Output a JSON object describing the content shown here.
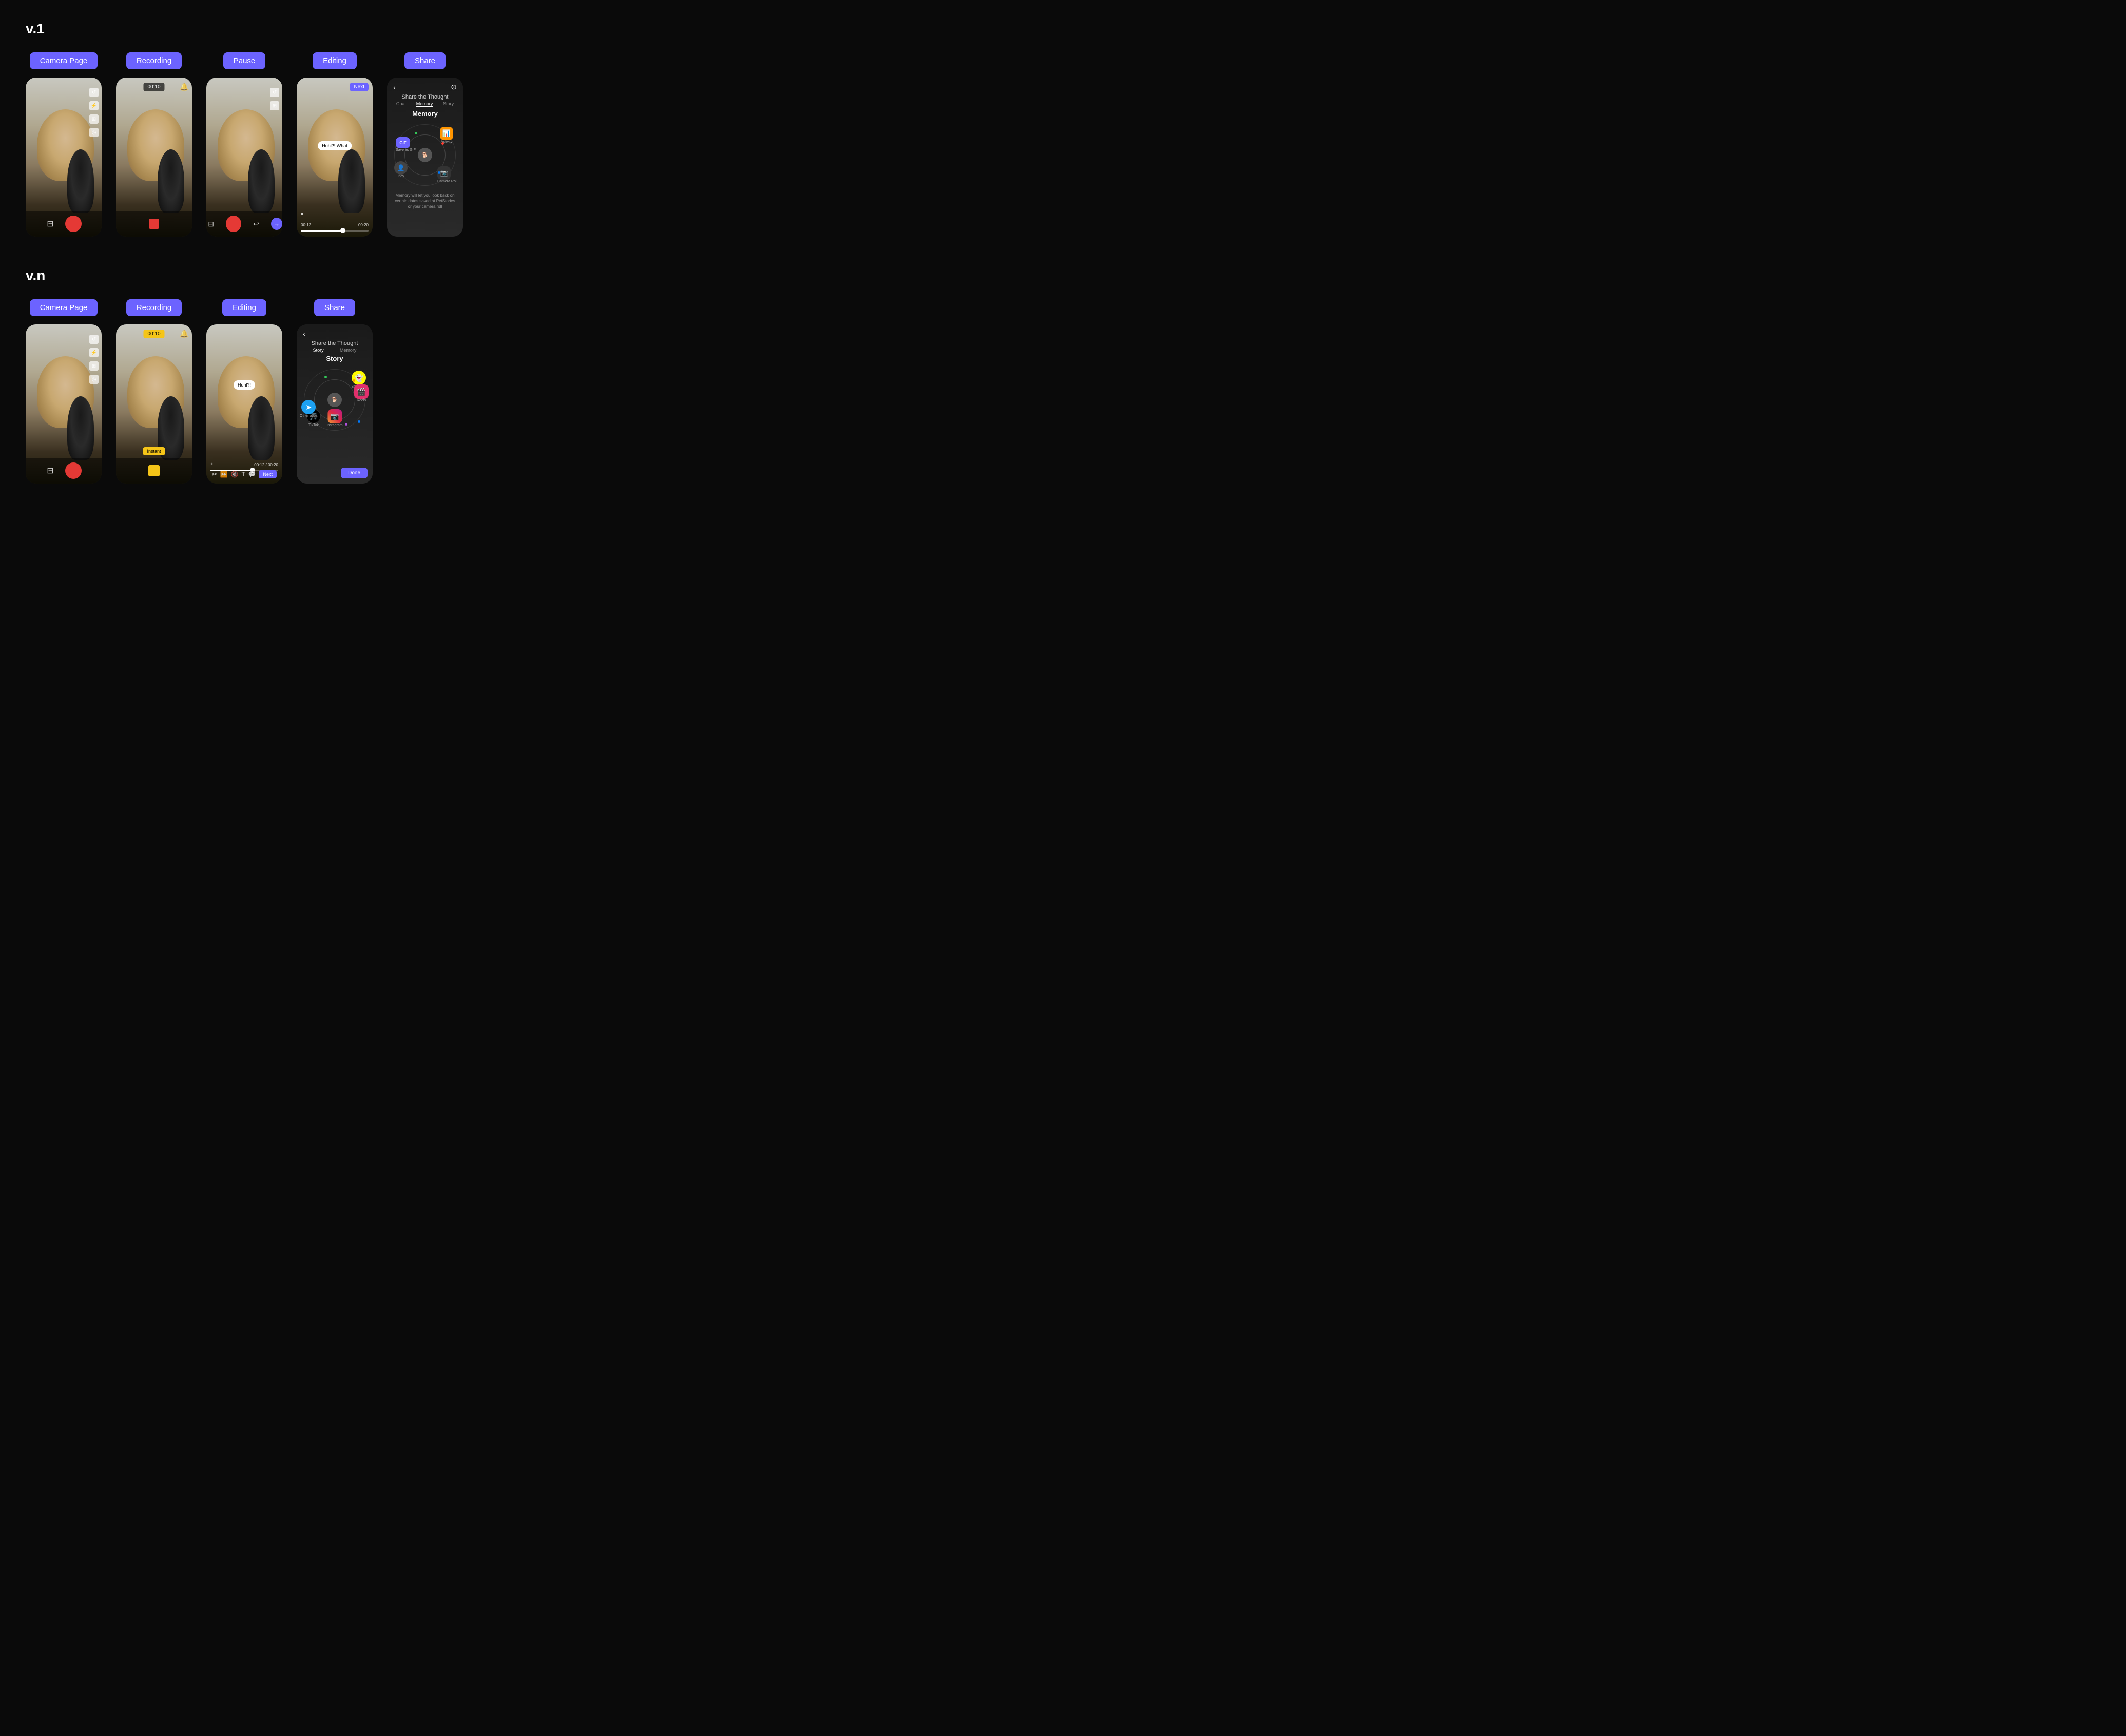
{
  "v1": {
    "label": "v.1",
    "screens": [
      {
        "id": "camera-page",
        "badge": "Camera Page",
        "type": "camera"
      },
      {
        "id": "recording",
        "badge": "Recording",
        "type": "recording",
        "timer": "00:10"
      },
      {
        "id": "pause",
        "badge": "Pause",
        "type": "pause"
      },
      {
        "id": "editing",
        "badge": "Editing",
        "type": "editing-v1",
        "next_label": "Next",
        "caption": "Huhl?! What",
        "time_current": "00:12",
        "time_total": "00:20"
      },
      {
        "id": "share",
        "badge": "Share",
        "type": "share-v1",
        "title": "Share the Thought",
        "subtitle": "Memory",
        "nav_items": [
          "Chat",
          "Memory",
          "Story"
        ],
        "items": [
          {
            "label": "GIF",
            "color": "#6c63ff"
          },
          {
            "label": "Activity",
            "color": "#ff9500"
          },
          {
            "label": "Save as GIF",
            "color": "#6c63ff"
          },
          {
            "label": "Indy",
            "color": "#666"
          },
          {
            "label": "Camera Roll",
            "color": "#555"
          }
        ],
        "footer": "Memory will let you look back on certain dates saved at PetStories or your camera roll"
      }
    ]
  },
  "v2": {
    "label": "v.n",
    "screens": [
      {
        "id": "camera-page-v2",
        "badge": "Camera Page",
        "type": "camera"
      },
      {
        "id": "recording-v2",
        "badge": "Recording",
        "type": "recording-v2",
        "timer": "00:10",
        "instant_label": "Instant"
      },
      {
        "id": "editing-v2",
        "badge": "Editing",
        "type": "editing-v2",
        "caption": "Huhl?!",
        "time_label": "00:12 / 00:20",
        "next_label": "Next"
      },
      {
        "id": "share-v2",
        "badge": "Share",
        "type": "share-v2",
        "title": "Share the Thought",
        "subtitle": "Story",
        "nav_items": [
          "Story",
          "Memory"
        ],
        "apps": [
          {
            "label": "TikTok",
            "emoji": "🎵",
            "color": "#000"
          },
          {
            "label": "Snapchat",
            "emoji": "👻",
            "color": "#fffc00"
          },
          {
            "label": "Instagram",
            "emoji": "📷",
            "color": "#c13584"
          },
          {
            "label": "Reels",
            "emoji": "🎬",
            "color": "#e1306c"
          },
          {
            "label": "Other apps",
            "emoji": "➤",
            "color": "#1da1f2"
          }
        ],
        "done_label": "Done"
      }
    ]
  }
}
